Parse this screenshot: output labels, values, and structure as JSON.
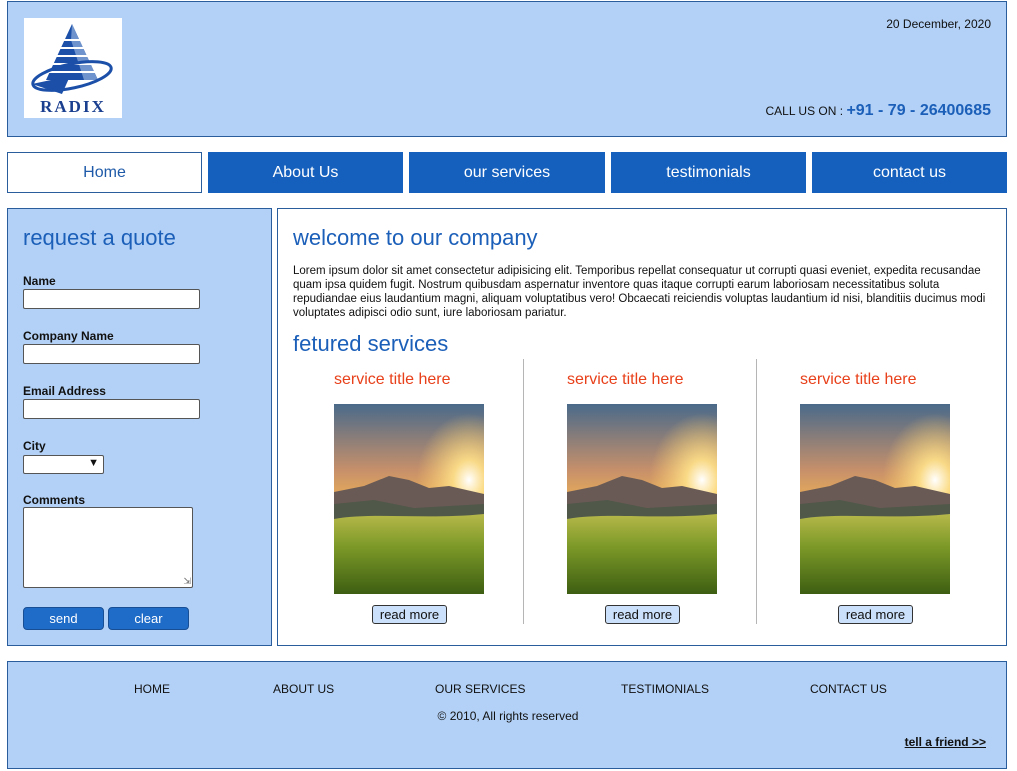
{
  "header": {
    "logo_text": "RADIX",
    "date": "20 December, 2020",
    "call_label": "CALL US ON : ",
    "phone": "+91 - 79 - 26400685"
  },
  "nav": {
    "items": [
      {
        "label": "Home"
      },
      {
        "label": "About Us"
      },
      {
        "label": "our services"
      },
      {
        "label": "testimonials"
      },
      {
        "label": "contact us"
      }
    ]
  },
  "quote_form": {
    "title": "request a quote",
    "name_label": "Name",
    "name_value": "",
    "company_label": "Company Name",
    "company_value": "",
    "email_label": "Email Address",
    "email_value": "",
    "city_label": "City",
    "city_value": "",
    "comments_label": "Comments",
    "comments_value": "",
    "send_label": "send",
    "clear_label": "clear"
  },
  "main": {
    "title": "welcome to our company",
    "intro": "Lorem ipsum dolor sit amet consectetur adipisicing elit. Temporibus repellat consequatur ut corrupti quasi eveniet, expedita recusandae quam ipsa quidem fugit. Nostrum quibusdam aspernatur inventore quas itaque corrupti earum laboriosam necessitatibus soluta repudiandae eius laudantium magni, aliquam voluptatibus vero! Obcaecati reiciendis voluptas laudantium id nisi, blanditiis ducimus modi voluptates adipisci odio sunt, iure laboriosam pariatur.",
    "featured_title": "fetured services",
    "services": [
      {
        "title": "service title here",
        "button": "read more"
      },
      {
        "title": "service title here",
        "button": "read more"
      },
      {
        "title": "service title here",
        "button": "read more"
      }
    ]
  },
  "footer": {
    "links": [
      {
        "label": "HOME"
      },
      {
        "label": "ABOUT US"
      },
      {
        "label": "OUR SERVICES"
      },
      {
        "label": "TESTIMONIALS"
      },
      {
        "label": "CONTACT US"
      }
    ],
    "copyright": "© 2010, All rights reserved",
    "tell_friend": "tell a friend >>"
  },
  "colors": {
    "panel_bg": "#b3d1f6",
    "accent_blue": "#1560bd",
    "heading_blue": "#1b5fb9",
    "service_title": "#e8401a"
  }
}
